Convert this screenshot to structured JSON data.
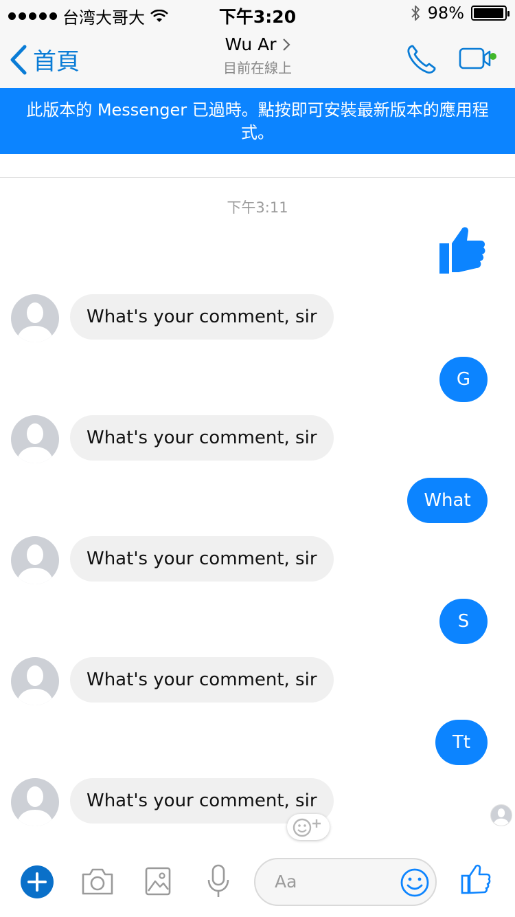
{
  "status_bar": {
    "carrier": "台湾大哥大",
    "time": "下午3:20",
    "battery": "98%",
    "battery_level": 0.98
  },
  "header": {
    "back_label": "首頁",
    "contact_name": "Wu Ar",
    "presence": "目前在線上",
    "icons": [
      "chevron-left-icon",
      "chevron-right-icon",
      "phone-icon",
      "video-camera-icon"
    ],
    "accent_color": "#0a7cd6",
    "online_color": "#42b72a"
  },
  "banner": {
    "text": "此版本的 Messenger 已過時。點按即可安裝最新版本的應用程式。",
    "color": "#0c84ff"
  },
  "conversation": {
    "timestamp": "下午3:11",
    "first_sent_icon": "thumbs-up-icon",
    "messages": [
      {
        "from": "them",
        "text": "What's your comment, sir"
      },
      {
        "from": "me",
        "text": "G"
      },
      {
        "from": "them",
        "text": "What's your comment, sir"
      },
      {
        "from": "me",
        "text": "What"
      },
      {
        "from": "them",
        "text": "What's your comment, sir"
      },
      {
        "from": "me",
        "text": "S"
      },
      {
        "from": "them",
        "text": "What's your comment, sir"
      },
      {
        "from": "me",
        "text": "Tt"
      },
      {
        "from": "them",
        "text": "What's your comment, sir"
      }
    ],
    "incoming_bubble_color": "#f0f0f0",
    "outgoing_bubble_color": "#0c84ff"
  },
  "composer": {
    "placeholder": "Aa",
    "icons": [
      "plus-icon",
      "camera-icon",
      "image-icon",
      "microphone-icon",
      "smiley-icon",
      "thumbs-up-icon"
    ]
  }
}
